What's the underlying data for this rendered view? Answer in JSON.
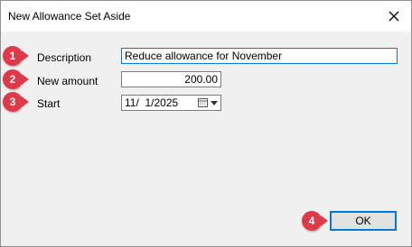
{
  "dialog": {
    "title": "New Allowance Set Aside"
  },
  "icons": {
    "close": "close-icon",
    "calendar": "calendar-icon",
    "dropdown": "chevron-down-icon"
  },
  "fields": {
    "description": {
      "label": "Description",
      "value": "Reduce allowance for November"
    },
    "amount": {
      "label": "New amount",
      "value": "200.00"
    },
    "start": {
      "label": "Start",
      "value": "11/  1/2025"
    }
  },
  "buttons": {
    "ok": "OK"
  },
  "callouts": [
    "1",
    "2",
    "3",
    "4"
  ],
  "colors": {
    "callout": "#e03a4a",
    "focus": "#0078d7"
  }
}
